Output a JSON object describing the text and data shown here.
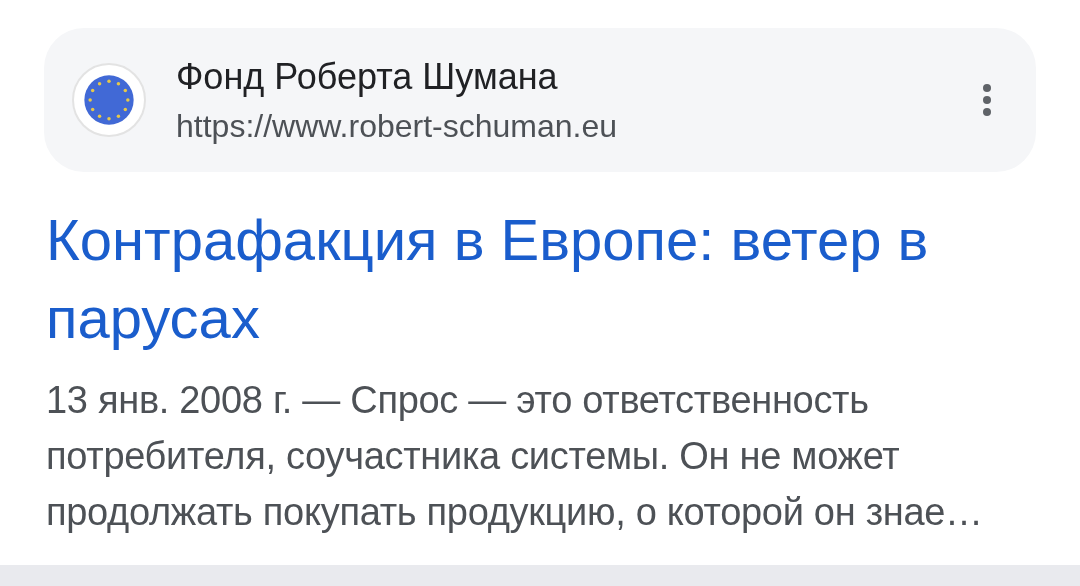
{
  "source": {
    "name": "Фонд Роберта Шумана",
    "url": "https://www.robert-schuman.eu"
  },
  "result": {
    "title": "Контрафакция в Европе: ветер в парусах",
    "date": "13 янв. 2008 г.",
    "snippet": "— Спрос — это ответственность потребителя, соучастника системы. Он не может продолжать покупать продукцию, о которой он знае…"
  }
}
